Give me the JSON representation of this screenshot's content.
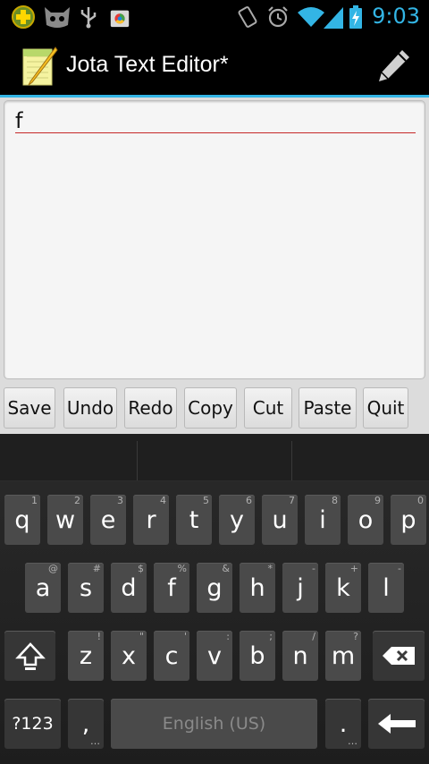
{
  "status_bar": {
    "time": "9:03",
    "accent": "#33b5e5"
  },
  "app": {
    "title": "Jota Text Editor*"
  },
  "editor": {
    "content": "f"
  },
  "toolbar": {
    "buttons": [
      "Save",
      "Undo",
      "Redo",
      "Copy",
      "Cut",
      "Paste",
      "Quit"
    ]
  },
  "keyboard": {
    "row1": [
      {
        "k": "q",
        "h": "1"
      },
      {
        "k": "w",
        "h": "2"
      },
      {
        "k": "e",
        "h": "3"
      },
      {
        "k": "r",
        "h": "4"
      },
      {
        "k": "t",
        "h": "5"
      },
      {
        "k": "y",
        "h": "6"
      },
      {
        "k": "u",
        "h": "7"
      },
      {
        "k": "i",
        "h": "8"
      },
      {
        "k": "o",
        "h": "9"
      },
      {
        "k": "p",
        "h": "0"
      }
    ],
    "row2": [
      {
        "k": "a",
        "h": "@"
      },
      {
        "k": "s",
        "h": "#"
      },
      {
        "k": "d",
        "h": "$"
      },
      {
        "k": "f",
        "h": "%"
      },
      {
        "k": "g",
        "h": "&"
      },
      {
        "k": "h",
        "h": "*"
      },
      {
        "k": "j",
        "h": "-"
      },
      {
        "k": "k",
        "h": "+"
      },
      {
        "k": "l",
        "h": "-"
      }
    ],
    "row3": [
      {
        "k": "z",
        "h": "!"
      },
      {
        "k": "x",
        "h": "\""
      },
      {
        "k": "c",
        "h": "'"
      },
      {
        "k": "v",
        "h": ":"
      },
      {
        "k": "b",
        "h": ";"
      },
      {
        "k": "n",
        "h": "/"
      },
      {
        "k": "m",
        "h": "?"
      }
    ],
    "symbols_label": "?123",
    "comma": ",",
    "space_label": "English (US)",
    "period": "."
  }
}
